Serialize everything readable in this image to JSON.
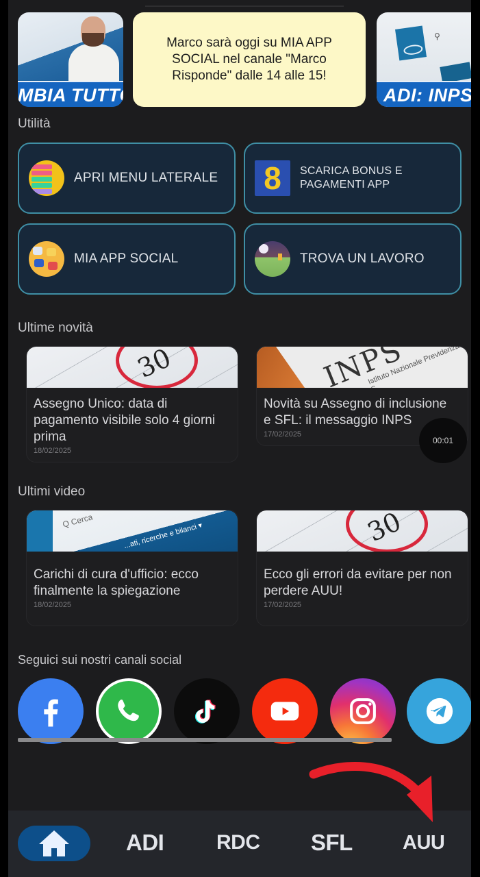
{
  "carousel": {
    "slides": [
      {
        "banner": "MBIA TUTTO"
      },
      {
        "text": "Marco sarà oggi su MIA APP SOCIAL nel canale \"Marco Risponde\" dalle 14 alle 15!"
      },
      {
        "banner": "ADI: INPS"
      }
    ]
  },
  "utility": {
    "title": "Utilità",
    "items": [
      {
        "label": "APRI MENU LATERALE",
        "icon": "menu-list-icon"
      },
      {
        "label": "SCARICA BONUS E PAGAMENTI APP",
        "icon": "bonus-app-icon"
      },
      {
        "label": "MIA APP SOCIAL",
        "icon": "social-apps-icon"
      },
      {
        "label": "TROVA UN LAVORO",
        "icon": "job-search-icon"
      }
    ]
  },
  "news": {
    "title": "Ultime novità",
    "items": [
      {
        "title": "Assegno Unico: data di pagamento visibile solo 4 giorni prima",
        "date": "18/02/2025",
        "thumb_text": "30"
      },
      {
        "title": "Novità su Assegno di inclusione e SFL: il messaggio INPS",
        "date": "17/02/2025",
        "thumb_text": "INPS",
        "thumb_sub": "Istituto Nazionale Previdenza S"
      }
    ]
  },
  "videos": {
    "title": "Ultimi video",
    "items": [
      {
        "title": "Carichi di cura d'ufficio: ecco finalmente la spiegazione",
        "date": "18/02/2025",
        "thumb_search": "Q Cerca",
        "thumb_text": "...ati, ricerche e bilanci ▾"
      },
      {
        "title": "Ecco gli errori da evitare per non perdere AUU!",
        "date": "17/02/2025",
        "thumb_text": "30"
      }
    ]
  },
  "video_timer": "00:01",
  "social": {
    "title": "Seguici sui nostri canali social",
    "items": [
      {
        "name": "Facebook",
        "color": "#3b7ff0"
      },
      {
        "name": "WhatsApp",
        "color": "#2fb84a"
      },
      {
        "name": "TikTok",
        "color": "#0c0c0c"
      },
      {
        "name": "YouTube",
        "color": "#f42b0e"
      },
      {
        "name": "Instagram",
        "color": "#d9317a"
      },
      {
        "name": "Telegram",
        "color": "#36a4dc"
      }
    ]
  },
  "bottom_nav": {
    "active": "home",
    "accent": "#0d4f8a",
    "items": [
      {
        "id": "home",
        "label": "Home",
        "icon": "home-icon"
      },
      {
        "id": "adi",
        "label": "ADI"
      },
      {
        "id": "rdc",
        "label": "RDC"
      },
      {
        "id": "sfl",
        "label": "SFL"
      },
      {
        "id": "auu",
        "label": "AUU"
      }
    ]
  },
  "annotation": {
    "type": "red-arrow",
    "points_to": "AUU",
    "color": "#e8202a"
  }
}
